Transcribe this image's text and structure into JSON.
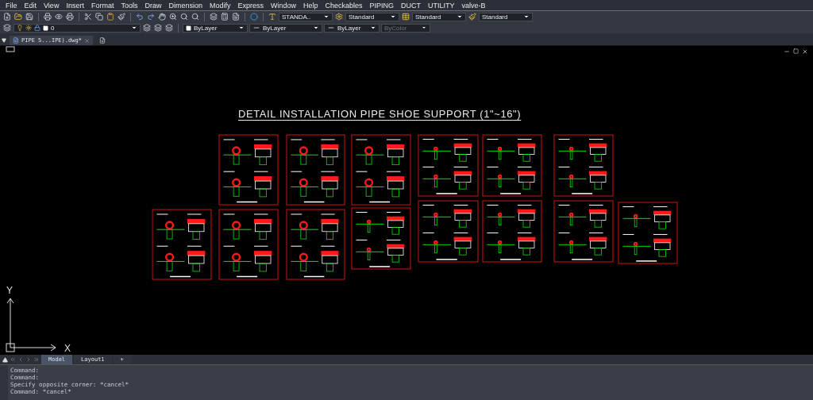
{
  "menu": [
    "File",
    "Edit",
    "View",
    "Insert",
    "Format",
    "Tools",
    "Draw",
    "Dimension",
    "Modify",
    "Express",
    "Window",
    "Help",
    "Checkables",
    "PIPING",
    "DUCT",
    "UTILITY",
    "valve-B"
  ],
  "style_dropdowns": [
    {
      "kind": "text",
      "value": "STANDA.."
    },
    {
      "kind": "dimension",
      "value": "Standard"
    },
    {
      "kind": "table",
      "value": "Standard"
    },
    {
      "kind": "multileader",
      "value": "Standard"
    }
  ],
  "properties": {
    "layer": "0",
    "color_setting": "ByLayer",
    "linetype": "ByLayer",
    "lineweight": "ByLayer",
    "plot_style": {
      "value": "ByColor",
      "disabled": true
    }
  },
  "file_tabs": [
    {
      "label": "PIPE 5...IPE).dwg*",
      "selected": true
    }
  ],
  "drawing": {
    "title": "DETAIL INSTALLATION PIPE SHOE SUPPORT (1\"~16\")",
    "sheets": [
      {
        "kind": "ring"
      },
      {
        "kind": "ring"
      },
      {
        "kind": "ring"
      },
      {
        "kind": "small"
      },
      {
        "kind": "small"
      },
      {
        "kind": "small"
      },
      {
        "kind": "ring"
      },
      {
        "kind": "ring"
      },
      {
        "kind": "ring"
      },
      {
        "kind": "small"
      },
      {
        "kind": "small"
      },
      {
        "kind": "small"
      },
      {
        "kind": "small"
      },
      {
        "kind": "small"
      }
    ]
  },
  "ucs": {
    "x_label": "X",
    "y_label": "Y"
  },
  "layout_tabs": [
    {
      "label": "Model",
      "selected": true
    },
    {
      "label": "Layout1",
      "selected": false
    },
    {
      "label": "+",
      "selected": false
    }
  ],
  "command_history": [
    "Command:",
    "Command:",
    "Specify opposite corner: *cancel*",
    "Command: *cancel*"
  ]
}
